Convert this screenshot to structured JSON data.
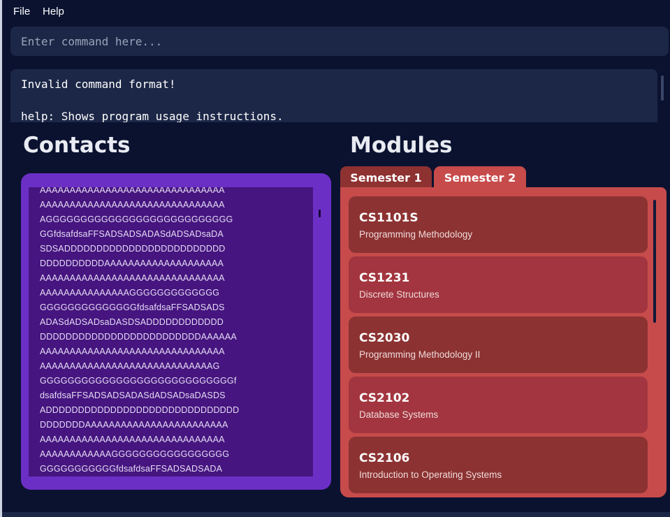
{
  "menu": {
    "file": "File",
    "help": "Help"
  },
  "command": {
    "placeholder": "Enter command here..."
  },
  "result": {
    "lines": [
      "Invalid command format!",
      "",
      "help: Shows program usage instructions."
    ]
  },
  "contacts": {
    "title": "Contacts",
    "lines": [
      "AAAAAAAAAAAAAAAAAAAAAAAAAAAAAAA",
      "AAAAAAAAAAAAAAAAAAAAAAAAAAAAAAA",
      "AGGGGGGGGGGGGGGGGGGGGGGGGGGG",
      "GGfdsafdsaFFSADSADSADASdADSADsaDA",
      "SDSADDDDDDDDDDDDDDDDDDDDDDDDD",
      "DDDDDDDDDDAAAAAAAAAAAAAAAAAAAA",
      "AAAAAAAAAAAAAAAAAAAAAAAAAAAAAAA",
      "AAAAAAAAAAAAAAAGGGGGGGGGGGGG",
      "GGGGGGGGGGGGGGfdsafdsaFFSADSADS",
      "ADASdADSADsaDASDSADDDDDDDDDDDD",
      "DDDDDDDDDDDDDDDDDDDDDDDDDAAAAAA",
      "AAAAAAAAAAAAAAAAAAAAAAAAAAAAAAA",
      "AAAAAAAAAAAAAAAAAAAAAAAAAAAAAG",
      "GGGGGGGGGGGGGGGGGGGGGGGGGGGGf",
      "dsafdsaFFSADSADSADASdADSADsaDASDS",
      "ADDDDDDDDDDDDDDDDDDDDDDDDDDDDDD",
      "DDDDDDDAAAAAAAAAAAAAAAAAAAAAAAA",
      "AAAAAAAAAAAAAAAAAAAAAAAAAAAAAAA",
      "AAAAAAAAAAAAGGGGGGGGGGGGGGGGG",
      "GGGGGGGGGGGfdsafdsaFFSADSADSADA"
    ]
  },
  "modules": {
    "title": "Modules",
    "tabs": [
      "Semester 1",
      "Semester 2"
    ],
    "active_tab": "Semester 2",
    "items": [
      {
        "code": "CS1101S",
        "name": "Programming Methodology"
      },
      {
        "code": "CS1231",
        "name": "Discrete Structures"
      },
      {
        "code": "CS2030",
        "name": "Programming Methodology II"
      },
      {
        "code": "CS2102",
        "name": "Database Systems"
      },
      {
        "code": "CS2106",
        "name": "Introduction to Operating Systems"
      }
    ]
  },
  "colors": {
    "background": "#0a1230",
    "contacts_panel": "#6c2fc6",
    "modules_panel": "#c74b4b",
    "module_card_dark": "#8c3232",
    "module_card_light": "#a2353f"
  }
}
